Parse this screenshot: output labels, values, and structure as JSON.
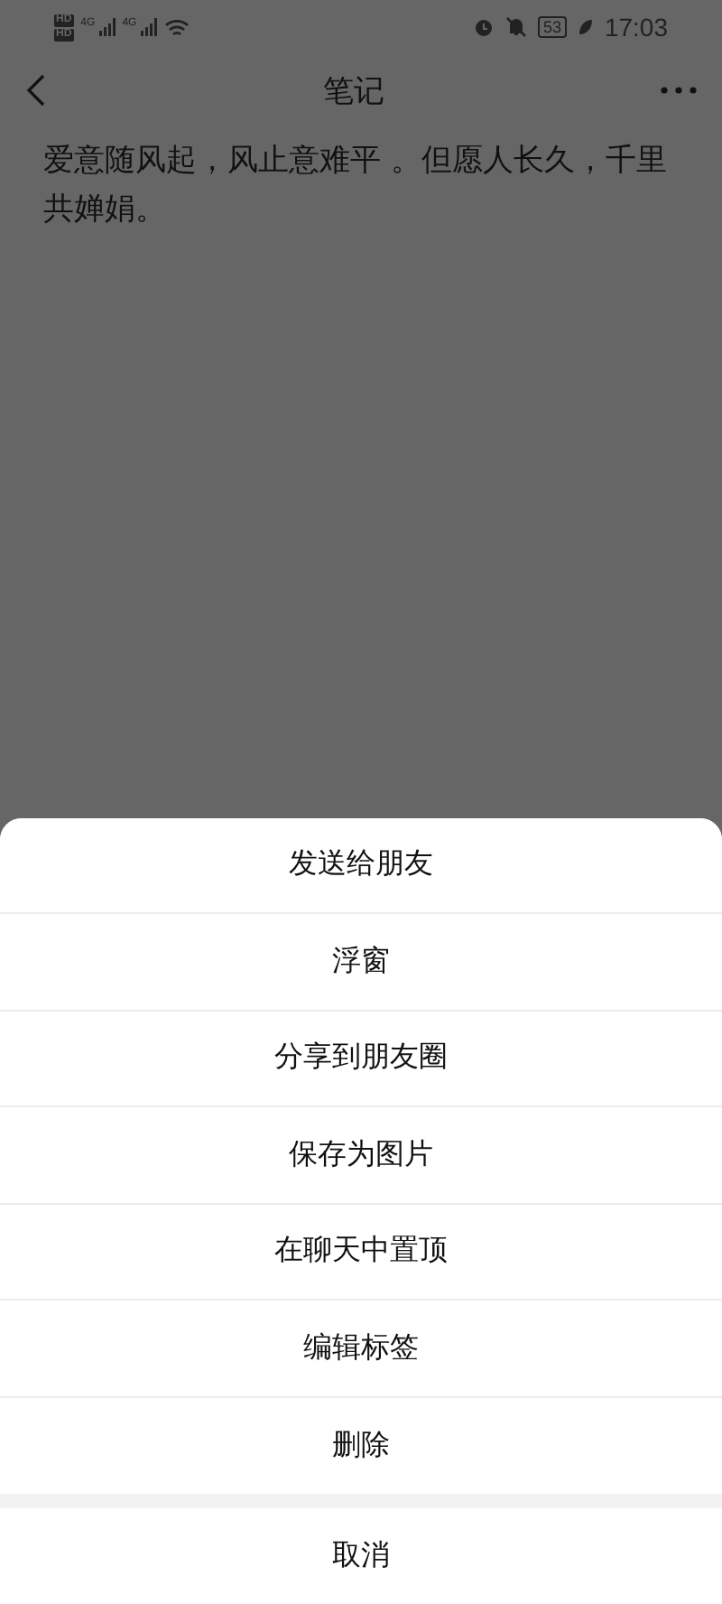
{
  "status_bar": {
    "sim_badges": [
      "HD",
      "HD"
    ],
    "network_labels": [
      "4G",
      "4G"
    ],
    "battery": "53",
    "time": "17:03"
  },
  "nav_bar": {
    "title": "笔记"
  },
  "note": {
    "text": "爱意随风起，风止意难平 。但愿人长久，千里共婵娟。"
  },
  "action_sheet": {
    "items": [
      {
        "label": "发送给朋友"
      },
      {
        "label": "浮窗"
      },
      {
        "label": "分享到朋友圈"
      },
      {
        "label": "保存为图片"
      },
      {
        "label": "在聊天中置顶"
      },
      {
        "label": "编辑标签"
      },
      {
        "label": "删除"
      }
    ],
    "cancel": "取消"
  }
}
